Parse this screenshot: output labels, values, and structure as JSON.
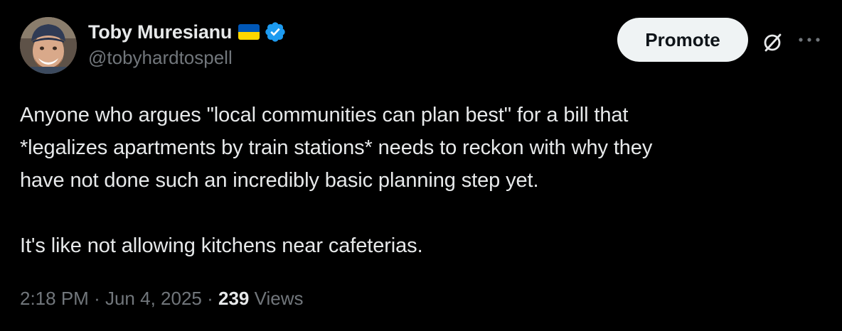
{
  "author": {
    "display_name": "Toby Muresianu",
    "handle": "@tobyhardtospell",
    "flag_emoji": "ukraine-flag-icon",
    "verified_icon": "verified-badge-icon"
  },
  "actions": {
    "promote_label": "Promote",
    "grok_icon": "grok-icon",
    "more_icon": "more-options-icon"
  },
  "tweet": {
    "lines": [
      "Anyone who argues \"local communities can plan best\" for a bill that",
      "*legalizes apartments by train stations* needs to reckon with why they",
      "have not done such an incredibly basic planning step yet.",
      "It's like not allowing kitchens near cafeterias."
    ]
  },
  "meta": {
    "time": "2:18 PM",
    "separator": "·",
    "date": "Jun 4, 2025",
    "views_count": "239",
    "views_label": "Views"
  },
  "colors": {
    "background": "#000000",
    "text_primary": "#e7e9ea",
    "text_secondary": "#71767b",
    "verified_blue": "#1d9bf0",
    "flag_blue": "#0057b7",
    "flag_yellow": "#ffd700",
    "button_bg": "#eff3f4"
  }
}
